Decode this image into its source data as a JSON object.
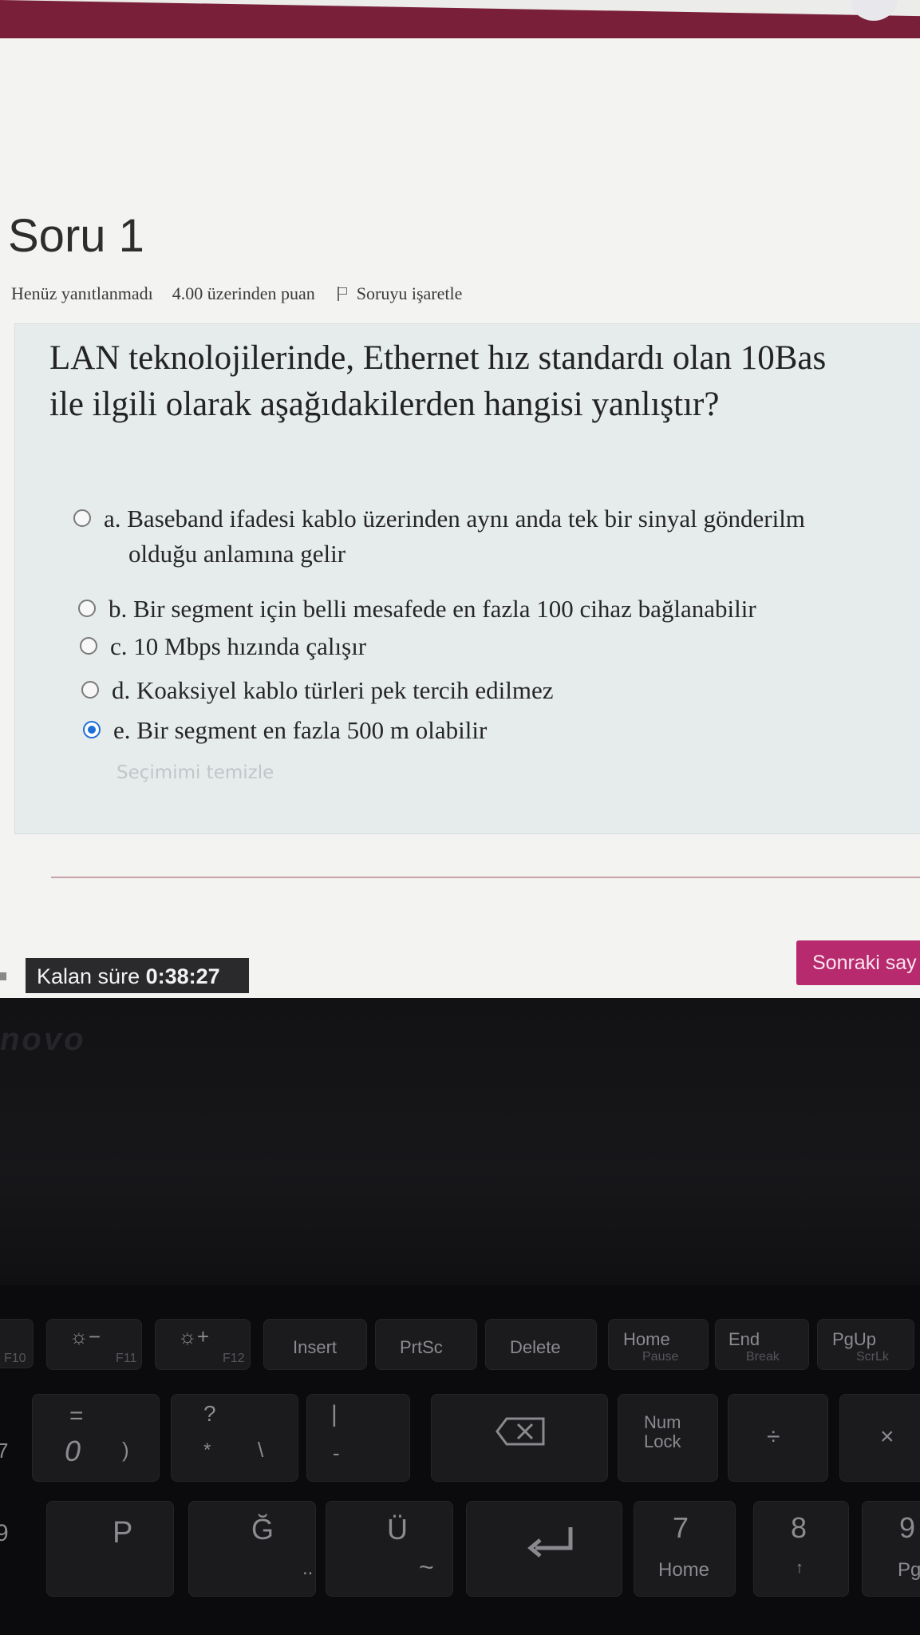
{
  "question": {
    "title": "Soru 1",
    "status": "Henüz yanıtlanmadı",
    "points": "4.00 üzerinden puan",
    "flag_label": "Soruyu işaretle",
    "text_line1": "LAN teknolojilerinde, Ethernet hız standardı olan 10Bas",
    "text_line2": "ile ilgili olarak aşağıdakilerden hangisi yanlıştır?",
    "options": [
      {
        "label": "a. Baseband ifadesi kablo üzerinden aynı anda tek bir sinyal gönderilm",
        "cont": "olduğu anlamına gelir",
        "selected": false
      },
      {
        "label": "b. Bir segment için belli mesafede en fazla 100 cihaz bağlanabilir",
        "selected": false
      },
      {
        "label": "c. 10 Mbps hızında çalışır",
        "selected": false
      },
      {
        "label": "d. Koaksiyel kablo türleri pek tercih edilmez",
        "selected": false
      },
      {
        "label": "e. Bir segment en fazla 500 m olabilir",
        "selected": true
      }
    ],
    "clear_choice": "Seçimimi temizle"
  },
  "timer": {
    "label": "Kalan süre",
    "value": "0:38:27"
  },
  "next_button": "Sonraki say",
  "laptop": {
    "brand": "novo",
    "keys": {
      "f10": "F10",
      "f11": "F11",
      "f12": "F12",
      "insert": "Insert",
      "prtsc": "PrtSc",
      "delete": "Delete",
      "home": "Home",
      "pause": "Pause",
      "end": "End",
      "break": "Break",
      "pgup": "PgUp",
      "scrlk": "ScrLk",
      "zero": "0",
      "paren": ")",
      "equals": "=",
      "star": "*",
      "question": "?",
      "backslash": "\\",
      "dash": "-",
      "pipe": "|",
      "num": "Num",
      "lock": "Lock",
      "divide": "÷",
      "times": "×",
      "p": "P",
      "g_breve": "Ğ",
      "u_uml": "Ü",
      "tilde": "~",
      "dots": "..",
      "seven": "7",
      "home2": "Home",
      "eight": "8",
      "up": "↑",
      "nine": "9",
      "pg": "Pg",
      "seven_left": "7",
      "nine_left": "9"
    }
  },
  "colors": {
    "topbar": "#7a1f3a",
    "next_button": "#b72a6d",
    "radio_selected": "#1e6fd9",
    "timer_bg": "#2a2a2d"
  },
  "icons": [
    "flag-icon",
    "radio-icon",
    "backspace-icon",
    "enter-icon",
    "brightness-down-icon",
    "brightness-up-icon"
  ]
}
